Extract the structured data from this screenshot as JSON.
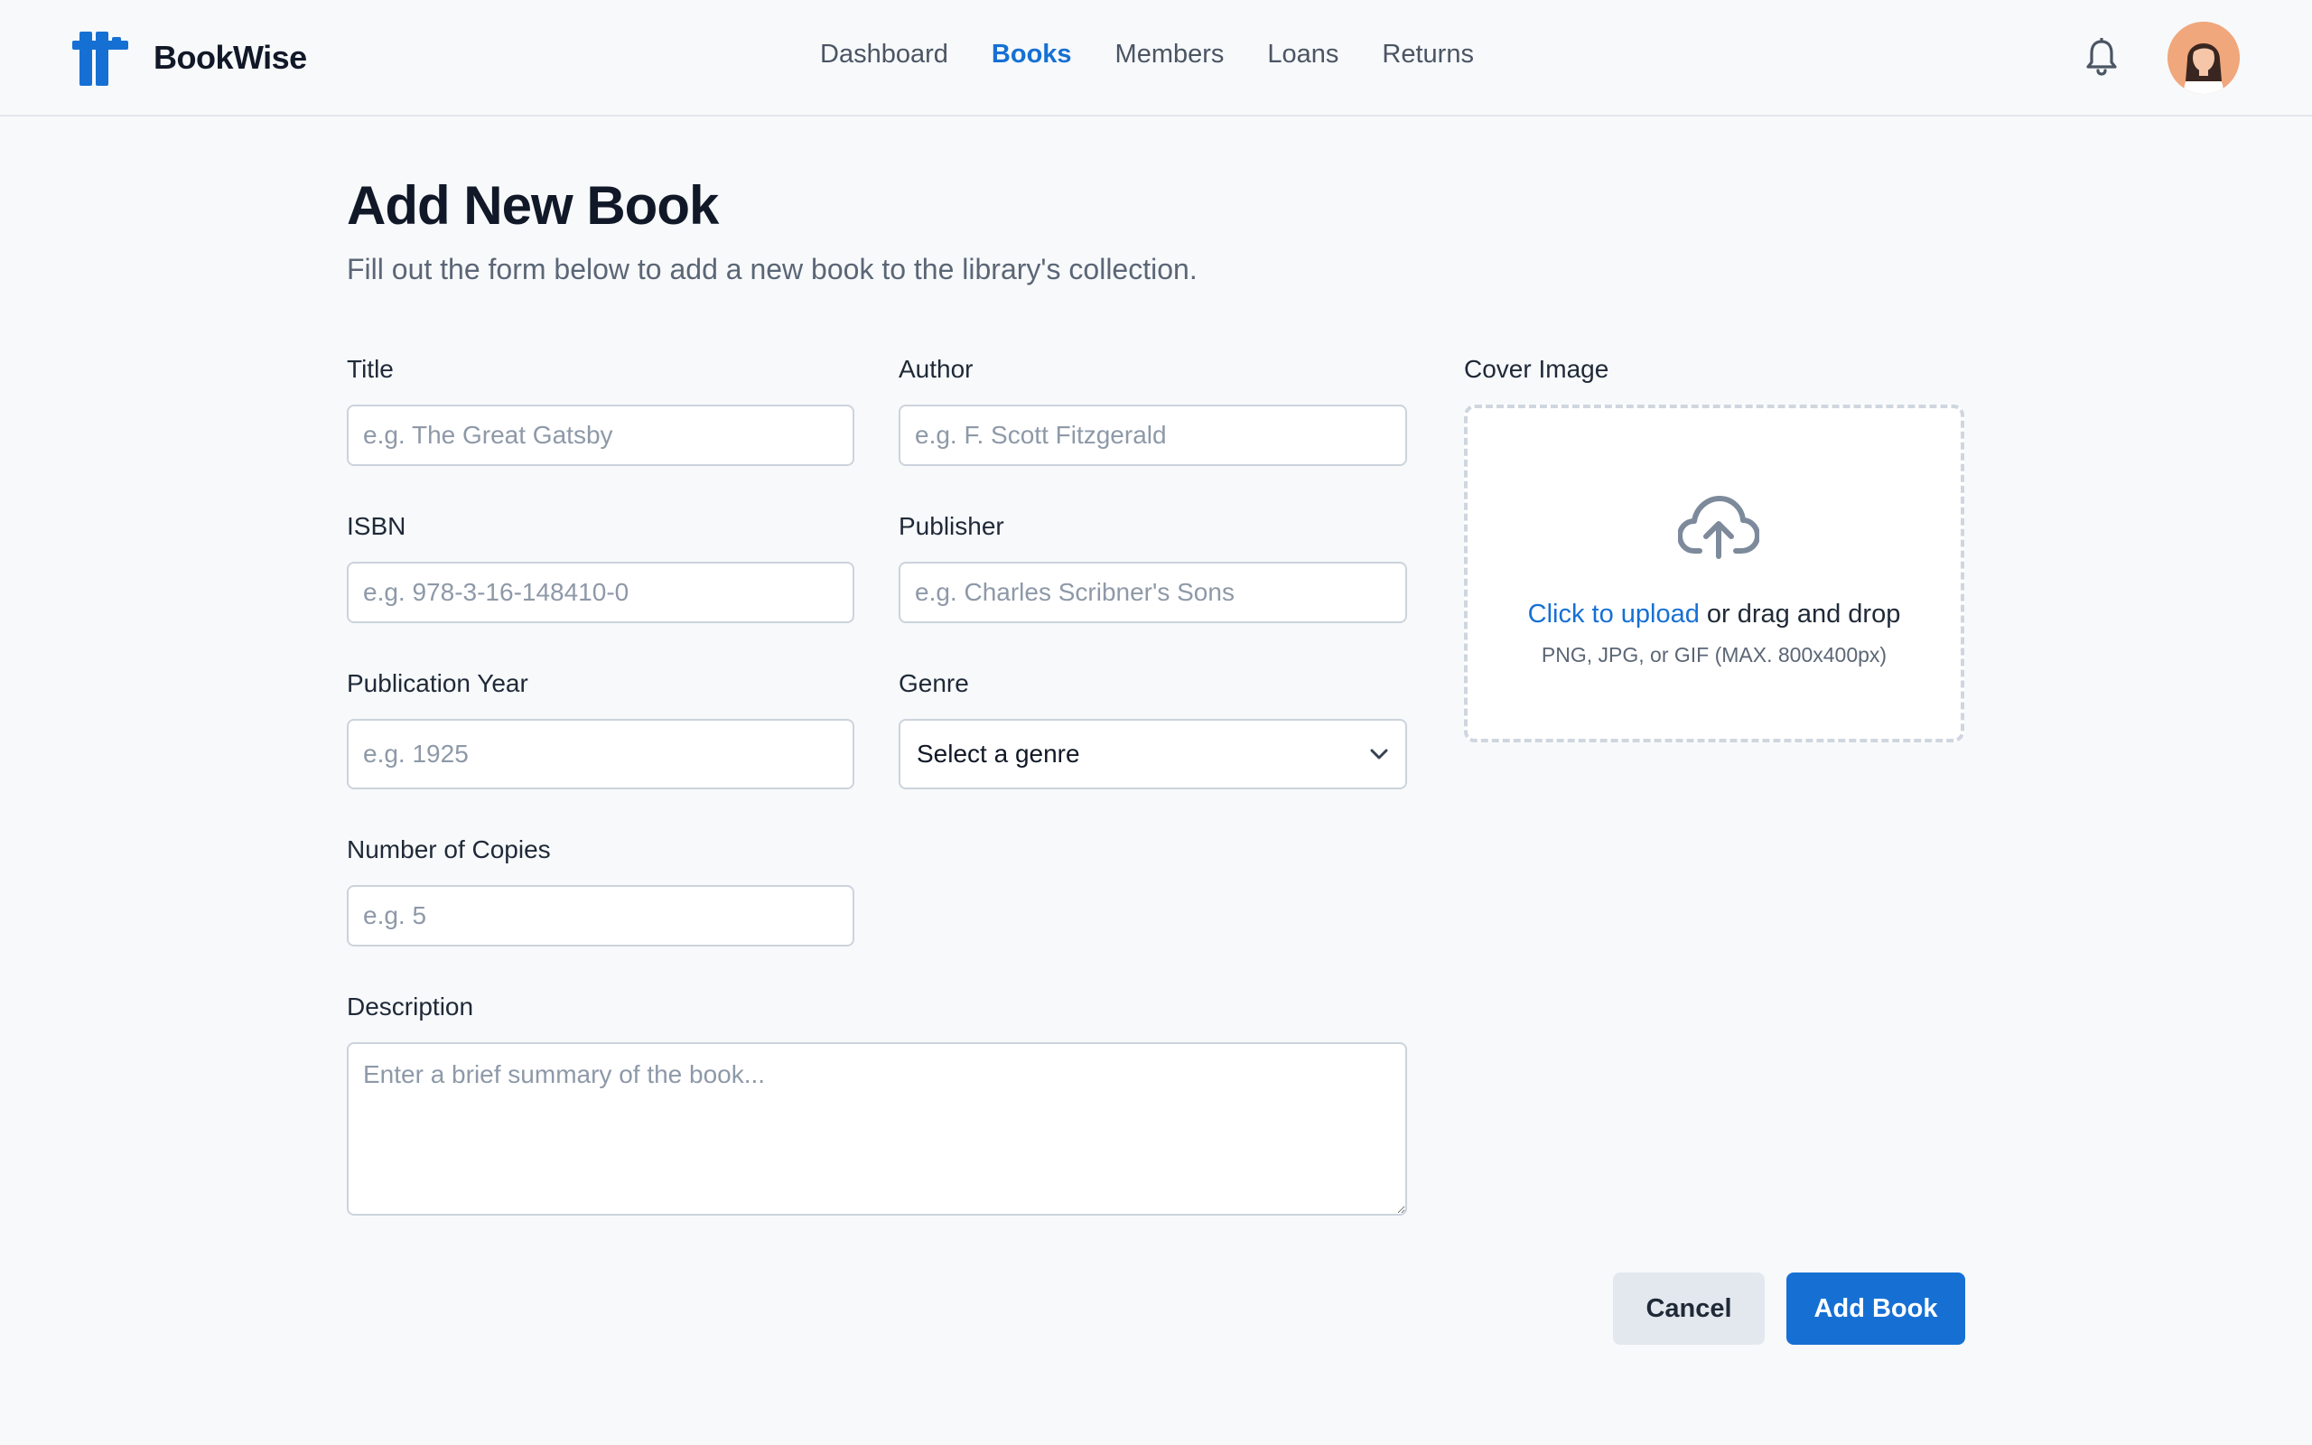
{
  "app": {
    "brand": "BookWise"
  },
  "nav": {
    "items": [
      {
        "label": "Dashboard",
        "active": false
      },
      {
        "label": "Books",
        "active": true
      },
      {
        "label": "Members",
        "active": false
      },
      {
        "label": "Loans",
        "active": false
      },
      {
        "label": "Returns",
        "active": false
      }
    ]
  },
  "header": {
    "icons": [
      "bell-icon",
      "avatar"
    ]
  },
  "page": {
    "title": "Add New Book",
    "subtitle": "Fill out the form below to add a new book to the library's collection."
  },
  "form": {
    "title": {
      "label": "Title",
      "placeholder": "e.g. The Great Gatsby",
      "value": ""
    },
    "author": {
      "label": "Author",
      "placeholder": "e.g. F. Scott Fitzgerald",
      "value": ""
    },
    "isbn": {
      "label": "ISBN",
      "placeholder": "e.g. 978-3-16-148410-0",
      "value": ""
    },
    "publisher": {
      "label": "Publisher",
      "placeholder": "e.g. Charles Scribner's Sons",
      "value": ""
    },
    "year": {
      "label": "Publication Year",
      "placeholder": "e.g. 1925",
      "value": ""
    },
    "genre": {
      "label": "Genre",
      "selected": "Select a genre"
    },
    "copies": {
      "label": "Number of Copies",
      "placeholder": "e.g. 5",
      "value": ""
    },
    "description": {
      "label": "Description",
      "placeholder": "Enter a brief summary of the book...",
      "value": ""
    },
    "cover": {
      "label": "Cover Image",
      "upload_link": "Click to upload",
      "upload_text": " or drag and drop",
      "hint": "PNG, JPG, or GIF (MAX. 800x400px)"
    }
  },
  "actions": {
    "cancel": "Cancel",
    "submit": "Add Book"
  },
  "colors": {
    "accent": "#1670d4",
    "background": "#f7f9fb",
    "border": "#ccd3dc"
  }
}
